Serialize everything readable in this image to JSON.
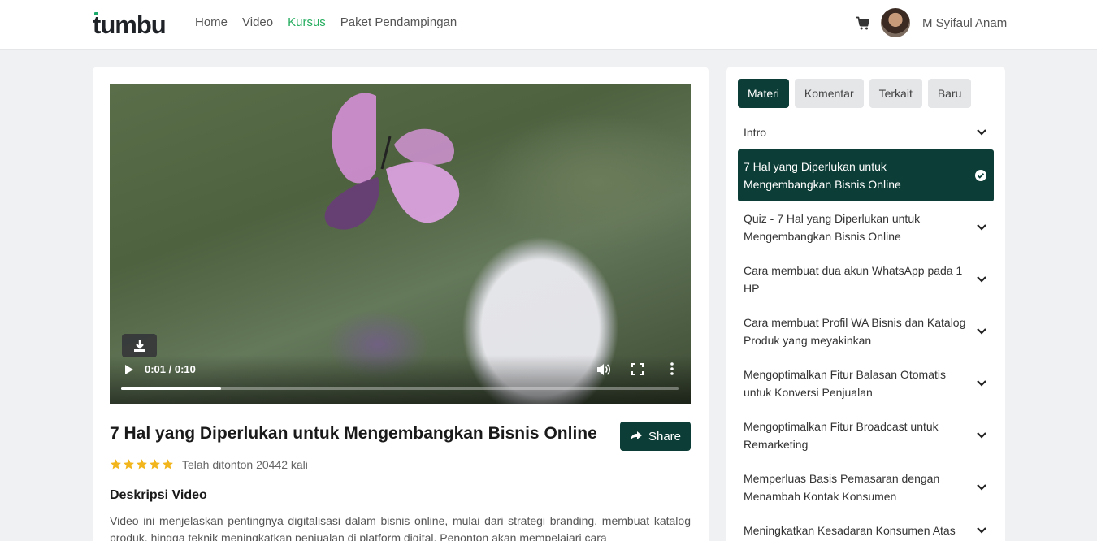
{
  "header": {
    "logo": "tumbu",
    "nav": [
      {
        "label": "Home",
        "active": false
      },
      {
        "label": "Video",
        "active": false
      },
      {
        "label": "Kursus",
        "active": true
      },
      {
        "label": "Paket Pendampingan",
        "active": false
      }
    ],
    "cart_icon": "cart-icon",
    "user_name": "M Syifaul Anam"
  },
  "player": {
    "time": "0:01 / 0:10",
    "progress_fraction": 0.18,
    "icons": [
      "download-icon",
      "play-icon",
      "volume-icon",
      "fullscreen-icon",
      "more-icon"
    ]
  },
  "video_info": {
    "title": "7 Hal yang Diperlukan untuk Mengembangkan Bisnis Online",
    "share_label": "Share",
    "rating_stars": 5,
    "views": "Telah ditonton 20442 kali",
    "desc_heading": "Deskripsi Video",
    "description": "Video ini menjelaskan pentingnya digitalisasi dalam bisnis online, mulai dari strategi branding, membuat katalog produk, hingga teknik meningkatkan penjualan di platform digital. Penonton akan mempelajari cara"
  },
  "sidebar": {
    "tabs": [
      {
        "label": "Materi",
        "active": true
      },
      {
        "label": "Komentar",
        "active": false
      },
      {
        "label": "Terkait",
        "active": false
      },
      {
        "label": "Baru",
        "active": false
      }
    ],
    "lessons": [
      {
        "label": "Intro",
        "active": false
      },
      {
        "label": "7 Hal yang Diperlukan untuk Mengembangkan Bisnis Online",
        "active": true
      },
      {
        "label": "Quiz - 7 Hal yang Diperlukan untuk Mengembangkan Bisnis Online",
        "active": false
      },
      {
        "label": "Cara membuat dua akun WhatsApp pada 1 HP",
        "active": false
      },
      {
        "label": "Cara membuat Profil WA Bisnis dan Katalog Produk yang meyakinkan",
        "active": false
      },
      {
        "label": "Mengoptimalkan Fitur Balasan Otomatis untuk Konversi Penjualan",
        "active": false
      },
      {
        "label": "Mengoptimalkan Fitur Broadcast untuk Remarketing",
        "active": false
      },
      {
        "label": "Memperluas Basis Pemasaran dengan Menambah Kontak Konsumen",
        "active": false
      },
      {
        "label": "Meningkatkan Kesadaran Konsumen Atas",
        "active": false
      }
    ]
  },
  "colors": {
    "brand_dark": "#0c3d36",
    "nav_active": "#27ae60",
    "star": "#f2b51c"
  }
}
